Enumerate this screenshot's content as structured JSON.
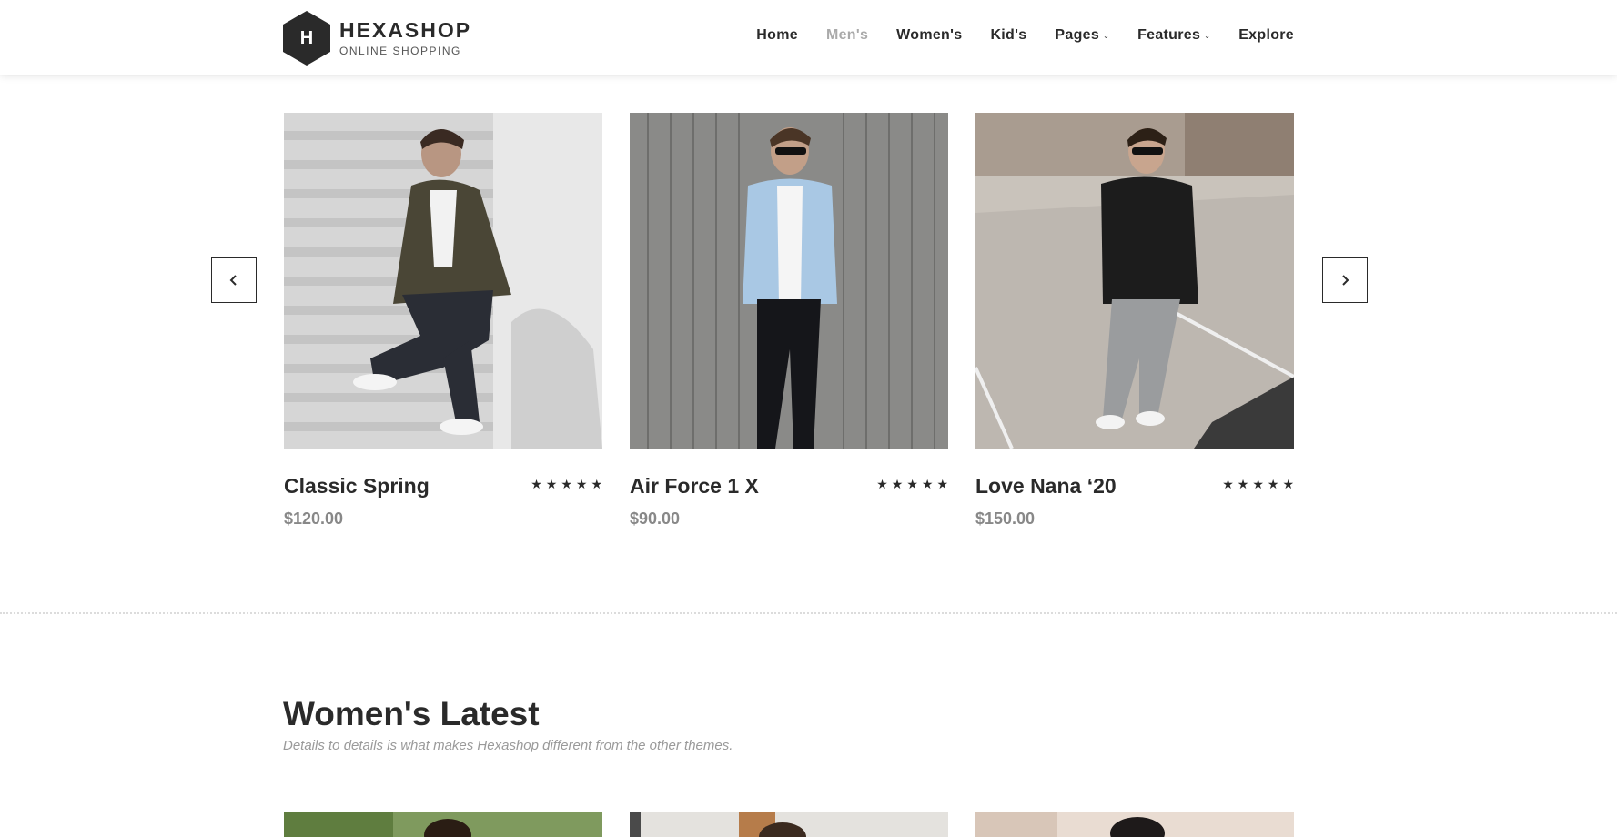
{
  "brand": {
    "logo_letter": "H",
    "name": "HEXASHOP",
    "tagline": "ONLINE SHOPPING"
  },
  "nav": {
    "items": [
      {
        "label": "Home",
        "active": false,
        "dropdown": false
      },
      {
        "label": "Men's",
        "active": true,
        "dropdown": false
      },
      {
        "label": "Women's",
        "active": false,
        "dropdown": false
      },
      {
        "label": "Kid's",
        "active": false,
        "dropdown": false
      },
      {
        "label": "Pages",
        "active": false,
        "dropdown": true
      },
      {
        "label": "Features",
        "active": false,
        "dropdown": true
      },
      {
        "label": "Explore",
        "active": false,
        "dropdown": false
      }
    ]
  },
  "carousel": {
    "prev_icon": "chevron-left-icon",
    "next_icon": "chevron-right-icon",
    "products": [
      {
        "title": "Classic Spring",
        "price": "$120.00",
        "rating": 5,
        "image": "man-camo-jacket-on-stairs"
      },
      {
        "title": "Air Force 1 X",
        "price": "$90.00",
        "rating": 5,
        "image": "man-denim-jacket-by-wooden-wall"
      },
      {
        "title": "Love Nana ‘20",
        "price": "$150.00",
        "rating": 5,
        "image": "man-black-sweater-on-street"
      }
    ]
  },
  "womens_section": {
    "title": "Women's Latest",
    "subtitle": "Details to details is what makes Hexashop different from the other themes."
  },
  "colors": {
    "text_dark": "#2a2a2a",
    "nav_active": "#aaaaaa",
    "price": "#888888"
  }
}
